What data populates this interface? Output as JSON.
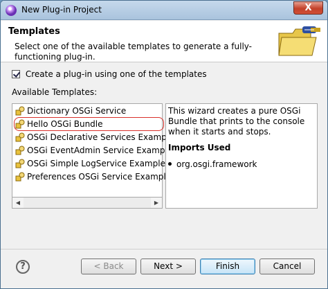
{
  "window": {
    "title": "New Plug-in Project",
    "close_glyph": "X"
  },
  "header": {
    "title": "Templates",
    "description": "Select one of the available templates to generate a fully-functioning plug-in."
  },
  "create_checkbox": {
    "checked": true,
    "label": "Create a plug-in using one of the templates"
  },
  "available_label": "Available Templates:",
  "templates": [
    {
      "label": "Dictionary OSGi Service",
      "icon": "plugin-template-icon",
      "selected": false
    },
    {
      "label": "Hello OSGi Bundle",
      "icon": "plugin-template-icon",
      "selected": true
    },
    {
      "label": "OSGi Declarative Services Example",
      "icon": "plugin-template-icon",
      "selected": false
    },
    {
      "label": "OSGi EventAdmin Service Example",
      "icon": "plugin-template-icon",
      "selected": false
    },
    {
      "label": "OSGi Simple LogService Example",
      "icon": "plugin-template-icon",
      "selected": false
    },
    {
      "label": "Preferences OSGi Service Example",
      "icon": "plugin-template-icon",
      "selected": false
    }
  ],
  "description": {
    "text": "This wizard creates a pure OSGi Bundle that prints to the console when it starts and stops.",
    "imports_label": "Imports Used",
    "imports": [
      "org.osgi.framework"
    ]
  },
  "buttons": {
    "help": "?",
    "back": "< Back",
    "next": "Next >",
    "finish": "Finish",
    "cancel": "Cancel"
  },
  "colors": {
    "selection_outline": "#d9302a",
    "default_button": "#3c7fb1"
  }
}
